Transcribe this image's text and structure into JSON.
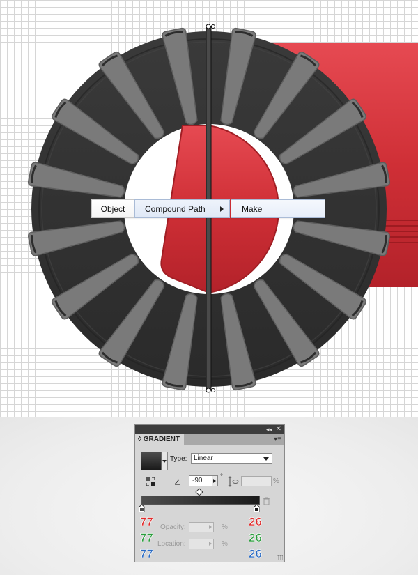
{
  "context_menu": {
    "items": [
      "Object",
      "Compound Path",
      "Make"
    ]
  },
  "gradient_panel": {
    "tab_title": "GRADIENT",
    "type_label": "Type:",
    "type_value": "Linear",
    "angle_value": "-90",
    "degree_symbol": "°",
    "aspect_unit": "%",
    "opacity_label": "Opacity:",
    "location_label": "Location:",
    "percent_symbol": "%",
    "left_stop_rgb": {
      "r": "77",
      "g": "77",
      "b": "77"
    },
    "right_stop_rgb": {
      "r": "26",
      "g": "26",
      "b": "26"
    },
    "colors": {
      "stop_left": "#4d4d4d",
      "stop_right": "#1a1a1a",
      "r_text": "#e02b2b",
      "g_text": "#2a9d3c",
      "b_text": "#2b6cc4"
    }
  },
  "artwork_colors": {
    "ring": "#333333",
    "ring_edge": "#252525",
    "spoke": "#7a7a7a",
    "spoke_outline": "#5f5f5f",
    "red_body": "#c4262c",
    "red_highlight": "#e0474f"
  }
}
